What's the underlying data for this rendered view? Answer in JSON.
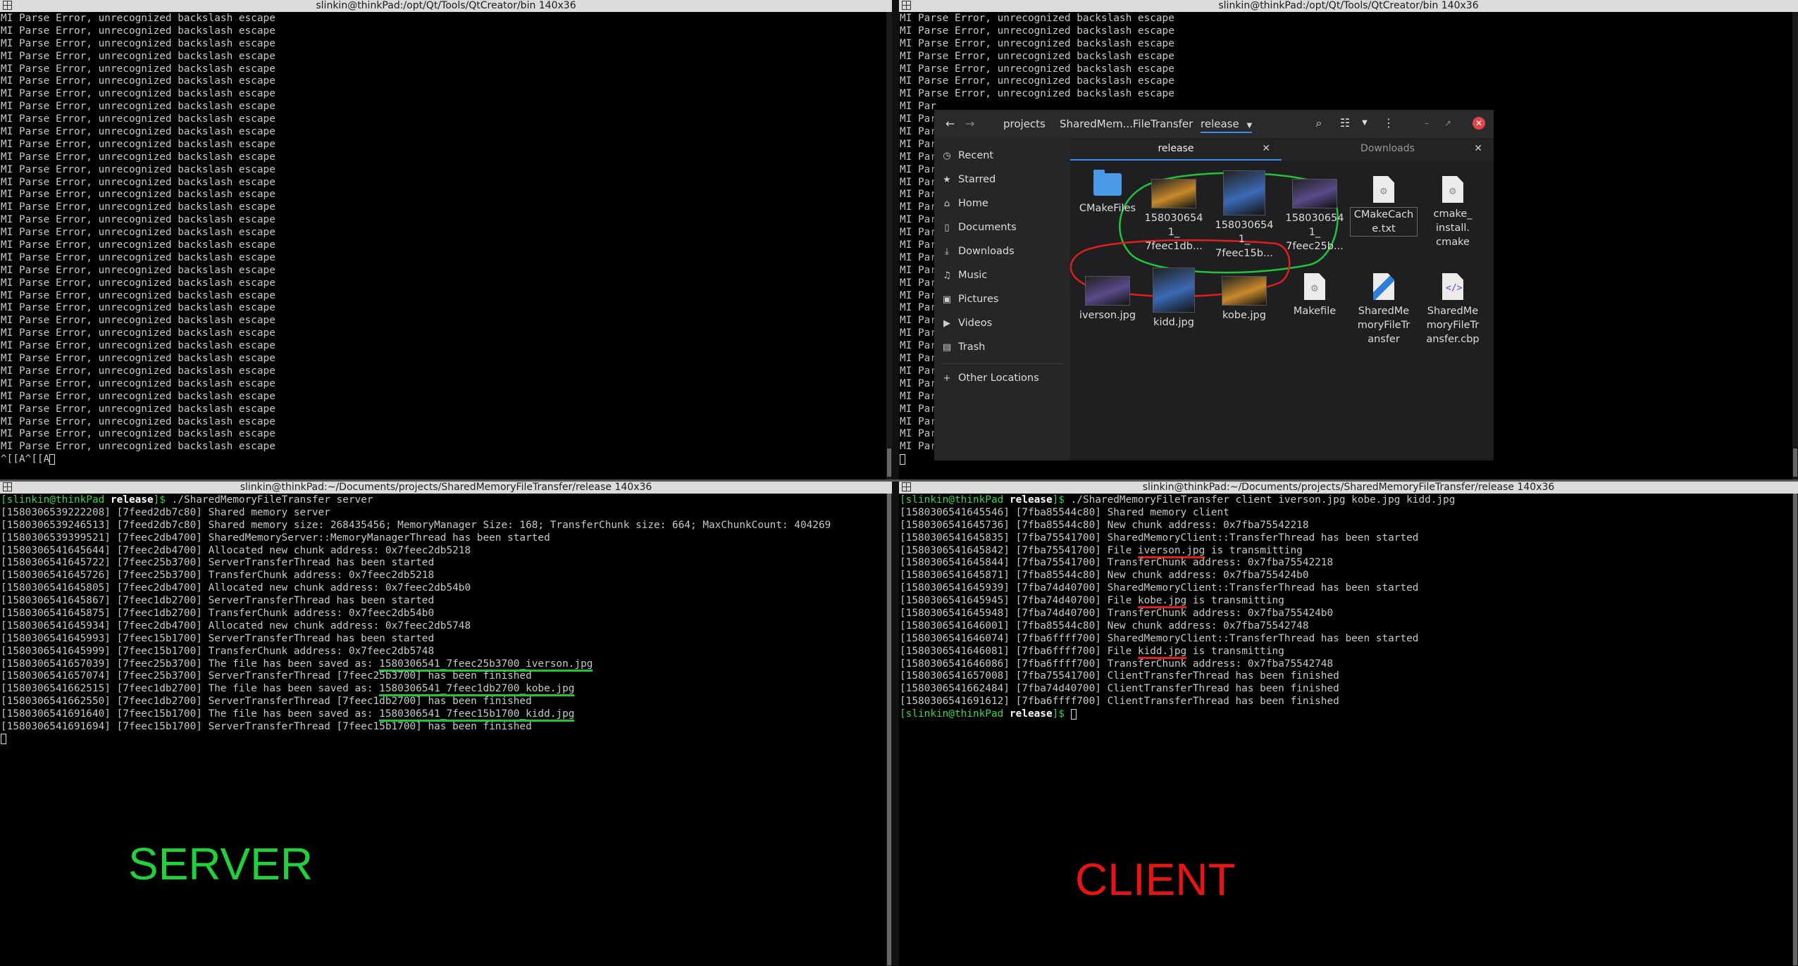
{
  "terminals": {
    "top_left": {
      "title": "slinkin@thinkPad:/opt/Qt/Tools/QtCreator/bin 140x36",
      "repeated_line": "MI Parse Error, unrecognized backslash escape",
      "last_line": "^[[A^[[A"
    },
    "top_right": {
      "title": "slinkin@thinkPad:/opt/Qt/Tools/QtCreator/bin 140x36",
      "repeated_line": "MI Parse Error, unrecognized backslash escape",
      "partial_line": "MI Par"
    },
    "server": {
      "title": "slinkin@thinkPad:~/Documents/projects/SharedMemoryFileTransfer/release 140x36",
      "prompt_user": "[slinkin@thinkPad",
      "prompt_dir": "release",
      "prompt_end": "]$",
      "command": " ./SharedMemoryFileTransfer server",
      "lines": [
        "[1580306539222208] [7feed2db7c80] Shared memory server",
        "[1580306539246513] [7feed2db7c80] Shared memory size: 268435456; MemoryManager Size: 168; TransferChunk size: 664; MaxChunkCount: 404269",
        "[1580306539399521] [7feec2db4700] SharedMemoryServer::MemoryManagerThread has been started",
        "[1580306541645644] [7feec2db4700] Allocated new chunk address: 0x7feec2db5218",
        "[1580306541645722] [7feec25b3700] ServerTransferThread has been started",
        "[1580306541645726] [7feec25b3700] TransferChunk address: 0x7feec2db5218",
        "[1580306541645805] [7feec2db4700] Allocated new chunk address: 0x7feec2db54b0",
        "[1580306541645867] [7feec1db2700] ServerTransferThread has been started",
        "[1580306541645875] [7feec1db2700] TransferChunk address: 0x7feec2db54b0",
        "[1580306541645934] [7feec2db4700] Allocated new chunk address: 0x7feec2db5748",
        "[1580306541645993] [7feec15b1700] ServerTransferThread has been started",
        "[1580306541645999] [7feec15b1700] TransferChunk address: 0x7feec2db5748",
        "[1580306541657039] [7feec25b3700] The file has been saved as: 1580306541_7feec25b3700_iverson.jpg",
        "[1580306541657074] [7feec25b3700] ServerTransferThread [7feec25b3700] has been finished",
        "[1580306541662515] [7feec1db2700] The file has been saved as: 1580306541_7feec1db2700_kobe.jpg",
        "[1580306541662550] [7feec1db2700] ServerTransferThread [7feec1db2700] has been finished",
        "[1580306541691640] [7feec15b1700] The file has been saved as: 1580306541_7feec15b1700_kidd.jpg",
        "[1580306541691694] [7feec15b1700] ServerTransferThread [7feec15b1700] has been finished"
      ],
      "big_label": "SERVER",
      "big_label_color": "#22d13a"
    },
    "client": {
      "title": "slinkin@thinkPad:~/Documents/projects/SharedMemoryFileTransfer/release 140x36",
      "prompt_user": "[slinkin@thinkPad",
      "prompt_dir": "release",
      "prompt_end": "]$",
      "command": " ./SharedMemoryFileTransfer client iverson.jpg kobe.jpg kidd.jpg",
      "lines": [
        "[1580306541645546] [7fba85544c80] Shared memory client",
        "[1580306541645736] [7fba85544c80] New chunk address: 0x7fba75542218",
        "[1580306541645835] [7fba75541700] SharedMemoryClient::TransferThread has been started",
        "[1580306541645842] [7fba75541700] File iverson.jpg is transmitting",
        "[1580306541645844] [7fba75541700] TransferChunk address: 0x7fba75542218",
        "[1580306541645871] [7fba85544c80] New chunk address: 0x7fba755424b0",
        "[1580306541645939] [7fba74d40700] SharedMemoryClient::TransferThread has been started",
        "[1580306541645945] [7fba74d40700] File kobe.jpg is transmitting",
        "[1580306541645948] [7fba74d40700] TransferChunk address: 0x7fba755424b0",
        "[1580306541646001] [7fba85544c80] New chunk address: 0x7fba75542748",
        "[1580306541646074] [7fba6ffff700] SharedMemoryClient::TransferThread has been started",
        "[1580306541646081] [7fba6ffff700] File kidd.jpg is transmitting",
        "[1580306541646086] [7fba6ffff700] TransferChunk address: 0x7fba75542748",
        "[1580306541657008] [7fba75541700] ClientTransferThread has been finished",
        "[1580306541662484] [7fba74d40700] ClientTransferThread has been finished",
        "[1580306541691612] [7fba6ffff700] ClientTransferThread has been finished"
      ],
      "big_label": "CLIENT",
      "big_label_color": "#e81414"
    }
  },
  "file_manager": {
    "breadcrumbs": [
      "projects",
      "SharedMem...FileTransfer",
      "release"
    ],
    "sidebar": [
      {
        "icon": "recent-icon",
        "label": "Recent"
      },
      {
        "icon": "star-icon",
        "label": "Starred"
      },
      {
        "icon": "home-icon",
        "label": "Home"
      },
      {
        "icon": "document-icon",
        "label": "Documents"
      },
      {
        "icon": "download-icon",
        "label": "Downloads"
      },
      {
        "icon": "music-icon",
        "label": "Music"
      },
      {
        "icon": "picture-icon",
        "label": "Pictures"
      },
      {
        "icon": "video-icon",
        "label": "Videos"
      },
      {
        "icon": "trash-icon",
        "label": "Trash"
      },
      {
        "icon": "plus-icon",
        "label": "Other Locations"
      }
    ],
    "tabs": [
      {
        "label": "release",
        "active": true
      },
      {
        "label": "Downloads",
        "active": false
      }
    ],
    "files": [
      {
        "name": "CMakeFiles",
        "kind": "folder"
      },
      {
        "name": "158030654 1_ 7feec1db...",
        "kind": "image",
        "tint": "#c88a2a"
      },
      {
        "name": "158030654 1_ 7feec15b...",
        "kind": "image",
        "tint": "#3b6ab5"
      },
      {
        "name": "158030654 1_ 7feec25b...",
        "kind": "image",
        "tint": "#5a4a8a"
      },
      {
        "name": "CMakeCach e.txt",
        "kind": "doc"
      },
      {
        "name": "cmake_ install. cmake",
        "kind": "doc"
      },
      {
        "name": "iverson.jpg",
        "kind": "image",
        "tint": "#5a4a8a"
      },
      {
        "name": "kidd.jpg",
        "kind": "image",
        "tint": "#3b6ab5"
      },
      {
        "name": "kobe.jpg",
        "kind": "image",
        "tint": "#c88a2a"
      },
      {
        "name": "Makefile",
        "kind": "doc"
      },
      {
        "name": "SharedMe moryFileTr ansfer",
        "kind": "exec"
      },
      {
        "name": "SharedMe moryFileTr ansfer.cbp",
        "kind": "code"
      }
    ]
  }
}
